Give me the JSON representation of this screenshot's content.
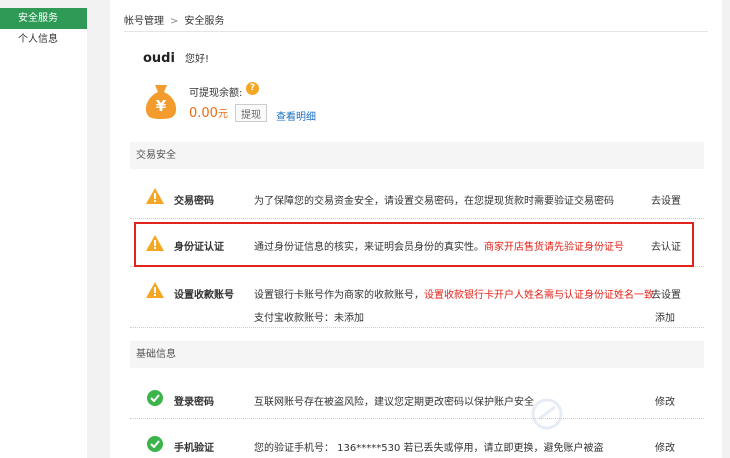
{
  "sidebar": {
    "items": [
      {
        "label": "安全服务",
        "active": true
      },
      {
        "label": "个人信息",
        "active": false
      }
    ]
  },
  "breadcrumb": {
    "parent": "帐号管理",
    "separator": ">",
    "current": "安全服务"
  },
  "user": {
    "name": "oudi",
    "greeting": "您好!"
  },
  "balance": {
    "label": "可提现余额:",
    "amount": "0.00",
    "unit": "元",
    "withdraw_label": "提现",
    "detail_link": "查看明细"
  },
  "sections": {
    "trade": {
      "title": "交易安全",
      "items": [
        {
          "icon": "warning-icon",
          "name": "交易密码",
          "desc": "为了保障您的交易资金安全，请设置交易密码，在您提现货款时需要验证交易密码",
          "action": "去设置"
        },
        {
          "icon": "warning-icon",
          "name": "身份证认证",
          "desc": "通过身份证信息的核实，来证明会员身份的真实性。",
          "desc_red": "商家开店售货请先验证身份证号",
          "action": "去认证"
        },
        {
          "icon": "warning-icon",
          "name": "设置收款账号",
          "desc": "设置银行卡账号作为商家的收款账号，",
          "desc_red": "设置收款银行卡开户人姓名需与认证身份证姓名一致",
          "action": "去设置",
          "desc2": "支付宝收款账号：未添加",
          "action2": "添加"
        }
      ]
    },
    "basic": {
      "title": "基础信息",
      "items": [
        {
          "icon": "check-icon",
          "name": "登录密码",
          "desc": "互联网账号存在被盗风险，建议您定期更改密码以保护账户安全",
          "action": "修改"
        },
        {
          "icon": "check-icon",
          "name": "手机验证",
          "desc": "您的验证手机号： 136*****530 若已丢失或停用，请立即更换，避免账户被盗",
          "action": "修改"
        }
      ]
    }
  },
  "colors": {
    "accent": "#2e9a55",
    "warning": "#f5a623",
    "success": "#3bb44a",
    "highlight": "#e0231b",
    "amount": "#f26a10",
    "link": "#1a6fc4"
  }
}
